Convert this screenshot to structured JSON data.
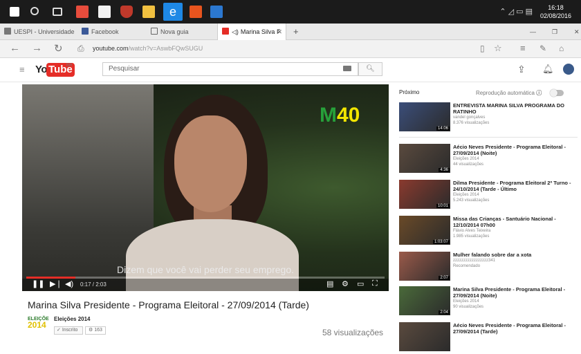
{
  "taskbar": {
    "time": "16:18",
    "date": "02/08/2016",
    "icons": [
      "windows-start",
      "search",
      "task-view",
      "mail",
      "store",
      "shield",
      "files",
      "edge",
      "office",
      "word"
    ]
  },
  "tabs": [
    {
      "label": "UESPI - Universidade"
    },
    {
      "label": "Facebook"
    },
    {
      "label": "Nova guia"
    },
    {
      "label": "Marina Silva F"
    }
  ],
  "address": {
    "domain": "youtube.com",
    "path": "/watch?v=AswbFQwSUGU"
  },
  "youtube": {
    "logo_you": "You",
    "logo_tube": "Tube",
    "logo_country": "BR",
    "search_placeholder": "Pesquisar"
  },
  "player": {
    "brand_m": "M",
    "brand_num": "40",
    "subtitle": "Dizem que você vai perder seu emprego.",
    "time": "0:17 / 2:03",
    "progress": 0.138
  },
  "video": {
    "title": "Marina Silva Presidente - Programa Eleitoral - 27/09/2014 (Tarde)",
    "channel": "Eleições 2014",
    "channel_logo_top": "ELEIÇÕE",
    "channel_logo_year": "2014",
    "subscribed_label": "Inscrito",
    "subscriber_count": "163",
    "views": "58 visualizações"
  },
  "sidebar": {
    "next_label": "Próximo",
    "autoplay_label": "Reprodução automática",
    "items": [
      {
        "title": "ENTREVISTA MARINA SILVA PROGRAMA DO RATINHO",
        "channel": "vandel gonçalves",
        "views": "8.376 visualizações",
        "duration": "14:06",
        "color": "#3b4e7a"
      },
      {
        "title": "Aécio Neves Presidente - Programa Eleitoral - 27/09/2014 (Noite)",
        "channel": "Eleições 2014",
        "views": "44 visualizações",
        "duration": "4:36",
        "color": "#5a4a3e"
      },
      {
        "title": "Dilma Presidente - Programa Eleitoral 2º Turno - 24/10/2014 (Tarde - Último",
        "channel": "Eleições 2014",
        "views": "5.243 visualizações",
        "duration": "10:01",
        "color": "#8a3a2e"
      },
      {
        "title": "Missa das Crianças - Santuário Nacional - 12/10/2014 07h00",
        "channel": "Flávio Alves Teixeira",
        "views": "1.985 visualizações",
        "duration": "1:03:07",
        "color": "#6a4a28"
      },
      {
        "title": "Mulher falando sobre dar a xota",
        "channel": "zzzzzzzzzzzzzzzzz341",
        "views": "Recomendado",
        "duration": "2:07",
        "color": "#9a5a4a"
      },
      {
        "title": "Marina Silva Presidente - Programa Eleitoral - 27/09/2014 (Noite)",
        "channel": "Eleições 2014",
        "views": "90 visualizações",
        "duration": "2:04",
        "color": "#4a6a3a"
      },
      {
        "title": "Aécio Neves Presidente - Programa Eleitoral - 27/09/2014 (Tarde)",
        "channel": "",
        "views": "",
        "duration": "",
        "color": "#5a4a3e"
      }
    ]
  }
}
